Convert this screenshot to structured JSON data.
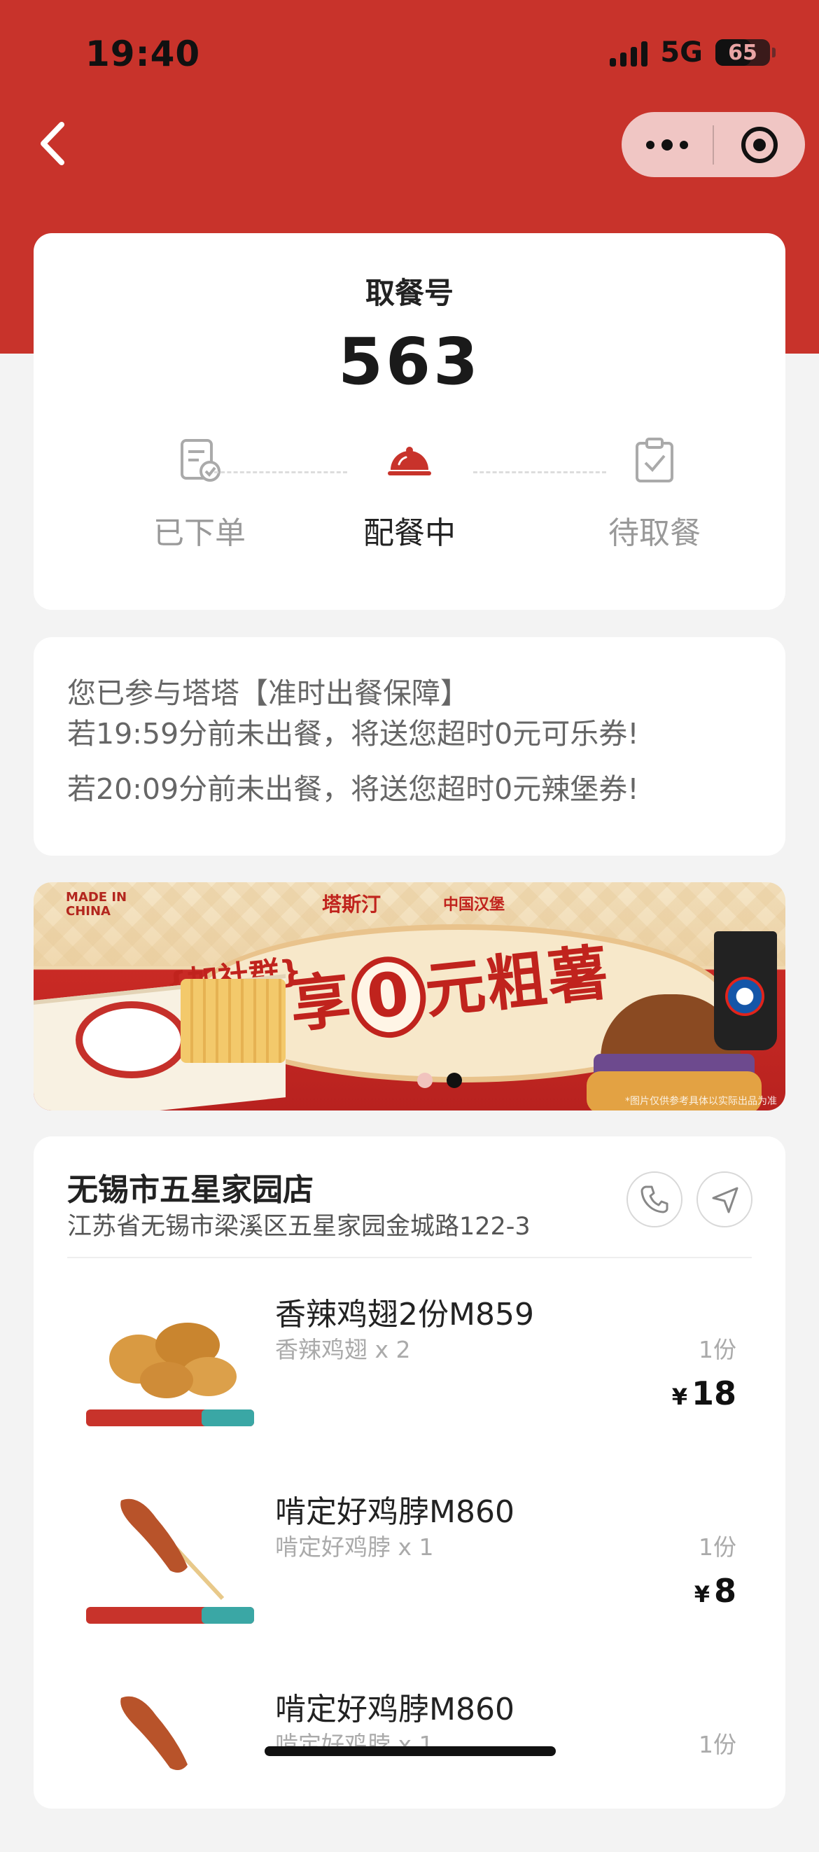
{
  "status_bar": {
    "time": "19:40",
    "network": "5G",
    "battery": "65"
  },
  "pickup": {
    "label": "取餐号",
    "number": "563",
    "steps": [
      {
        "label": "已下单",
        "icon": "order-placed-icon",
        "active": false
      },
      {
        "label": "配餐中",
        "icon": "food-cloche-icon",
        "active": true
      },
      {
        "label": "待取餐",
        "icon": "clipboard-check-icon",
        "active": false
      }
    ]
  },
  "notice": {
    "line1": "您已参与塔塔【准时出餐保障】",
    "line2": "若19:59分前未出餐，将送您超时0元可乐券!",
    "line3": "若20:09分前未出餐，将送您超时0元辣堡券!"
  },
  "banner": {
    "made_in": "MADE IN CHINA",
    "brand": "塔斯汀",
    "brand_sub": "中国汉堡",
    "slogan_pre": "{加社群}",
    "slogan_a": "享",
    "slogan_zero": "0",
    "slogan_b": "元粗薯",
    "disclaimer": "*图片仅供参考具体以实际出品为准",
    "page_count": 2,
    "active_page": 2
  },
  "store": {
    "name": "无锡市五星家园店",
    "address": "江苏省无锡市梁溪区五星家园金城路122-3"
  },
  "items": [
    {
      "name": "香辣鸡翅2份M859",
      "desc": "香辣鸡翅 x 2",
      "qty": "1份",
      "currency": "¥",
      "price": "18"
    },
    {
      "name": "啃定好鸡脖M860",
      "desc": "啃定好鸡脖 x 1",
      "qty": "1份",
      "currency": "¥",
      "price": "8"
    },
    {
      "name": "啃定好鸡脖M860",
      "desc": "啃定好鸡脖 x 1",
      "qty": "1份",
      "currency": "¥",
      "price": ""
    }
  ],
  "colors": {
    "brand_red": "#c8332b",
    "background": "#f3f3f3"
  }
}
